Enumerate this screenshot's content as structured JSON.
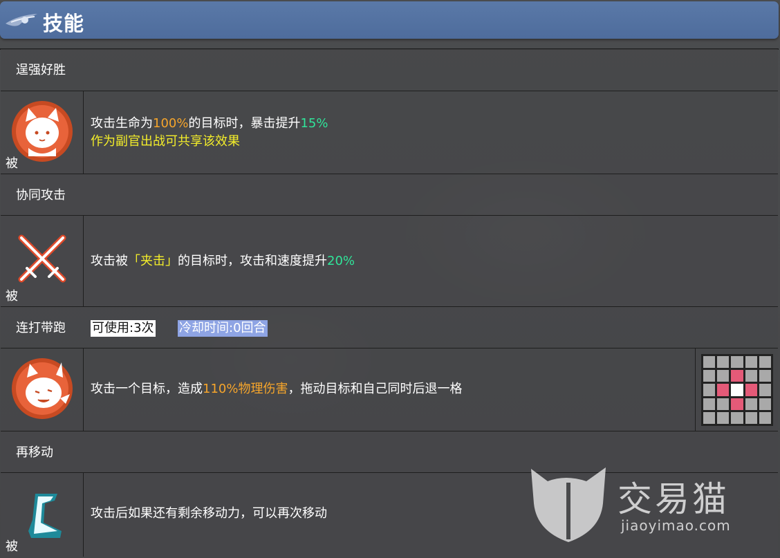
{
  "header": {
    "title": "技能"
  },
  "skills": [
    {
      "name": "逞强好胜",
      "passive_tag": "被",
      "icon": "fox-girl-portrait-icon",
      "desc": [
        {
          "parts": [
            "攻击生命为",
            "100%",
            "的目标时，暴击提升",
            "15%"
          ]
        },
        {
          "parts": [
            "作为副官出战可共享该效果"
          ]
        }
      ]
    },
    {
      "name": "协同攻击",
      "passive_tag": "被",
      "icon": "crossed-swords-icon",
      "desc": [
        {
          "parts": [
            "攻击被",
            "「夹击」",
            "的目标时，攻击和速度提升",
            "20%"
          ]
        }
      ]
    },
    {
      "name": "连打带跑",
      "uses": "可使用:3次",
      "cooldown": "冷却时间:0回合",
      "icon": "fox-girl-attack-icon",
      "desc": [
        {
          "parts": [
            "攻击一个目标，造成",
            "110%物理伤害",
            "，拖动目标和自己同时后退一格"
          ]
        }
      ],
      "range_grid": [
        [
          "empty",
          "empty",
          "empty",
          "empty",
          "empty"
        ],
        [
          "empty",
          "empty",
          "attack",
          "empty",
          "empty"
        ],
        [
          "empty",
          "attack",
          "self",
          "attack",
          "empty"
        ],
        [
          "empty",
          "empty",
          "attack",
          "empty",
          "empty"
        ],
        [
          "empty",
          "empty",
          "empty",
          "empty",
          "empty"
        ]
      ]
    },
    {
      "name": "再移动",
      "passive_tag": "被",
      "icon": "boot-icon",
      "desc": [
        {
          "parts": [
            "攻击后如果还有剩余移动力，可以再次移动"
          ]
        }
      ]
    }
  ],
  "watermark": {
    "brand_cn": "交易猫",
    "brand_en": "jiaoyimao.com"
  },
  "colors": {
    "header": "#5a79a8",
    "orange": "#f6a52b",
    "green": "#30e59a",
    "yellow": "#f4ee2a",
    "cooldown_bg": "#8ea4e4"
  }
}
